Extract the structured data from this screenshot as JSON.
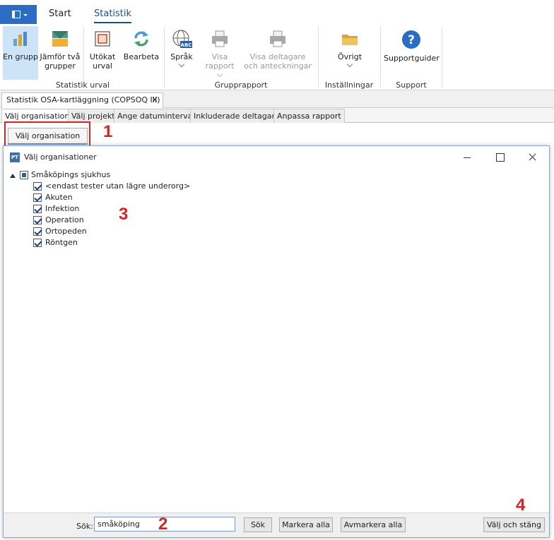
{
  "ribbon_tabs": {
    "start": "Start",
    "statistik": "Statistik"
  },
  "ribbon": {
    "one_group": "En grupp",
    "compare_line1": "Jämför två",
    "compare_line2": "grupper",
    "extended_line1": "Utökat",
    "extended_line2": "urval",
    "process": "Bearbeta",
    "language": "Språk",
    "show_report": "Visa rapport",
    "show_participants_line1": "Visa deltagare",
    "show_participants_line2": "och anteckningar",
    "other": "Övrigt",
    "support_guides": "Supportguider",
    "group_statistics": "Statistik urval",
    "group_report": "Grupprapport",
    "group_settings": "Inställningar",
    "group_support": "Support",
    "language_badge": "ABC",
    "support_glyph": "?"
  },
  "document_tab": {
    "title": "Statistik OSA-kartläggning (COPSOQ III)",
    "close": "×"
  },
  "sub_tabs": [
    "Välj organisation",
    "Välj projekt",
    "Ange datumintervall",
    "Inkluderade deltagare",
    "Anpassa rapport"
  ],
  "choose_org_button": "Välj organisation",
  "annotations": [
    "1",
    "2",
    "3",
    "4"
  ],
  "dialog": {
    "icon_text": "PT",
    "title": "Välj organisationer",
    "tree": {
      "root": "Småköpings sjukhus",
      "children": [
        "<endast tester utan lägre underorg>",
        "Akuten",
        "Infektion",
        "Operation",
        "Ortopeden",
        "Röntgen"
      ]
    },
    "search_label": "Sök:",
    "search_value": "småköping",
    "btn_search": "Sök",
    "btn_mark_all": "Markera alla",
    "btn_unmark_all": "Avmarkera alla",
    "btn_select_close": "Välj och stäng"
  },
  "colors": {
    "accent": "#2b6cc4",
    "annotation": "#e02020",
    "selected": "#cde3f7"
  }
}
